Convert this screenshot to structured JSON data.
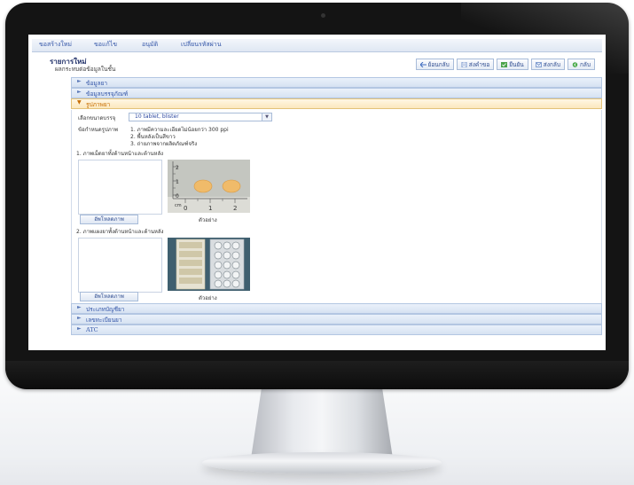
{
  "topnav": {
    "items": [
      "ขอสร้างใหม่",
      "ขอแก้ไข",
      "อนุมัติ",
      "เปลี่ยนรหัสผ่าน"
    ]
  },
  "page": {
    "title": "รายการใหม่",
    "subtitle": "ผลกระทบต่อข้อมูลในชั้น"
  },
  "toolbar": {
    "buttons": [
      {
        "label": "ย้อนกลับ",
        "icon": "back-arrow-icon"
      },
      {
        "label": "ส่งคำขอ",
        "icon": "document-icon"
      },
      {
        "label": "ยืนยัน",
        "icon": "check-icon"
      },
      {
        "label": "ส่งกลับ",
        "icon": "return-icon"
      },
      {
        "label": "กลับ",
        "icon": "home-icon"
      }
    ]
  },
  "sections": {
    "drug_info": "ข้อมูลยา",
    "packaging": "ข้อมูลบรรจุภัณฑ์",
    "appearance": "รูปภาพยา",
    "accounting": "ประเภทบัญชียา",
    "registration": "เลขทะเบียนยา",
    "atc": "ATC"
  },
  "appearance": {
    "package_label": "เลือกขนาดบรรจุ",
    "package_value": "10 tablet, blister",
    "requirements_label": "ข้อกำหนดรูปภาพ",
    "requirements": [
      "1. ภาพมีความละเอียดไม่น้อยกว่า 300 ppi",
      "2. พื้นหลังเป็นสีขาว",
      "3. ถ่ายภาพจากผลิตภัณฑ์จริง"
    ],
    "section1_title": "1. ภาพเม็ดยาทั้งด้านหน้าและด้านหลัง",
    "section2_title": "2. ภาพแผงยาทั้งด้านหน้าและด้านหลัง",
    "upload_label": "อัพโหลดภาพ",
    "sample_label": "ตัวอย่าง"
  },
  "ruler": {
    "unit": "cm",
    "ticks": [
      "0",
      "1",
      "2"
    ],
    "vticks": [
      "2",
      "1",
      "0"
    ]
  },
  "colors": {
    "link": "#3456a8",
    "open_section": "#c76c00",
    "tablet": "#f0bb6a"
  }
}
